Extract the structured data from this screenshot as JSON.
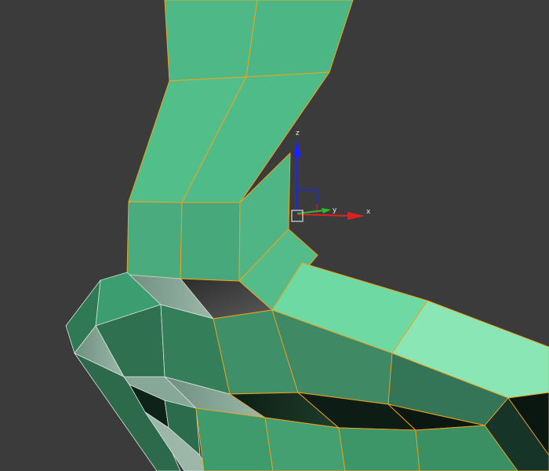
{
  "viewport": {
    "background": "#3b3b3b",
    "selection_edge_color": "#f2a21c"
  },
  "gizmo": {
    "axes": [
      {
        "name": "z",
        "label": "z",
        "color": "#1a22ff"
      },
      {
        "name": "y",
        "label": "y",
        "color": "#2fb82f"
      },
      {
        "name": "x",
        "label": "x",
        "color": "#e02020"
      }
    ],
    "pivot_icon": "pivot-square-icon"
  }
}
